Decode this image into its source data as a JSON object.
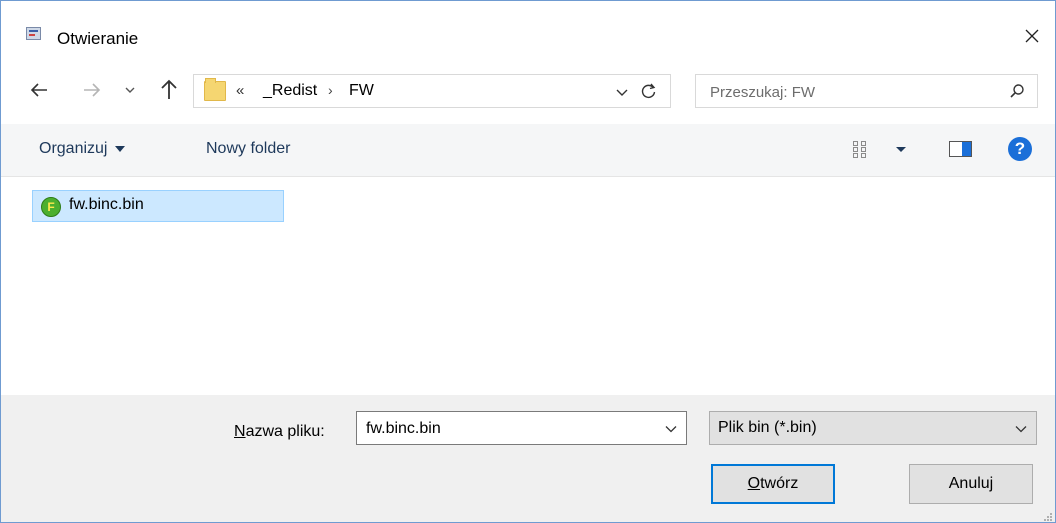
{
  "window": {
    "title": "Otwieranie",
    "close_glyph": "✕"
  },
  "navigation": {
    "back_icon": "arrow-left-icon",
    "forward_icon": "arrow-right-icon",
    "recent_icon": "chevron-down-icon",
    "up_icon": "arrow-up-icon"
  },
  "address": {
    "overflow": "«",
    "breadcrumbs": [
      "_Redist",
      "FW"
    ],
    "separator": "›"
  },
  "search": {
    "placeholder": "Przeszukaj: FW"
  },
  "toolbar": {
    "organize_label": "Organizuj",
    "new_folder_label": "Nowy folder",
    "help_glyph": "?"
  },
  "files": [
    {
      "name": "fw.binc.bin",
      "selected": true,
      "icon": "green-f-file-icon"
    }
  ],
  "footer": {
    "filename_label_prefix": "N",
    "filename_label_rest": "azwa pliku:",
    "filename_value": "fw.binc.bin",
    "filetype_value": "Plik bin (*.bin)",
    "open_label_prefix": "O",
    "open_label_rest": "twórz",
    "cancel_label": "Anuluj"
  },
  "colors": {
    "accent": "#0078d7",
    "selection": "#cce8ff",
    "toolbar_bg": "#f5f6f7",
    "footer_bg": "#f0f0f0"
  }
}
